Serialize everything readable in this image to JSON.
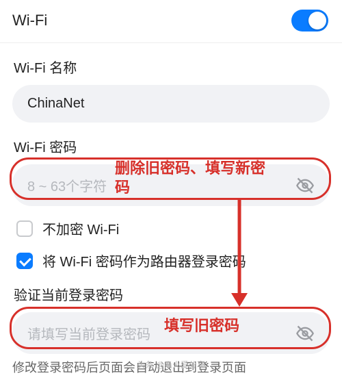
{
  "header": {
    "title": "Wi-Fi",
    "toggle_on": true
  },
  "wifi_name": {
    "label": "Wi-Fi 名称",
    "value": "ChinaNet"
  },
  "wifi_password": {
    "label": "Wi-Fi 密码",
    "placeholder": "8 ~ 63个字符"
  },
  "no_encrypt": {
    "label": "不加密 Wi-Fi",
    "checked": false
  },
  "use_as_login": {
    "label": "将 Wi-Fi 密码作为路由器登录密码",
    "checked": true
  },
  "verify": {
    "label": "验证当前登录密码",
    "placeholder": "请填写当前登录密码"
  },
  "footer_hint": "修改登录密码后页面会自动退出到登录页面",
  "annotations": {
    "pw_note": "删除旧密码、填写新密码",
    "verify_note": "填写旧密码"
  },
  "watermark": "头条 @焱火爱分享"
}
